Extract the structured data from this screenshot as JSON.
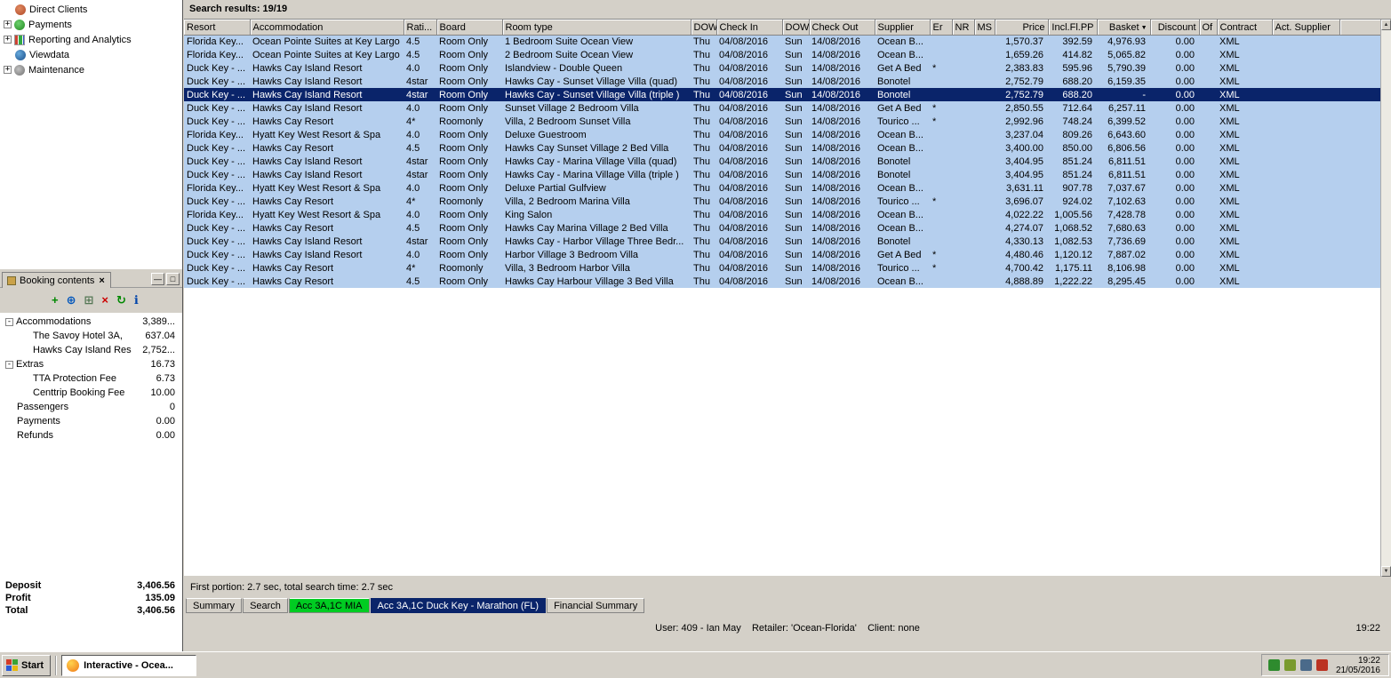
{
  "colors": {
    "selection": "#0a246a",
    "row_highlight": "#b5cfee",
    "tab_green": "#00cc22",
    "window_gray": "#d4d0c8"
  },
  "nav_tree": {
    "items": [
      {
        "label": "Direct Clients",
        "icon": "direct-clients",
        "expandable": false
      },
      {
        "label": "Payments",
        "icon": "payments",
        "expandable": true
      },
      {
        "label": "Reporting and Analytics",
        "icon": "reporting",
        "expandable": true
      },
      {
        "label": "Viewdata",
        "icon": "viewdata",
        "expandable": false
      },
      {
        "label": "Maintenance",
        "icon": "maintenance",
        "expandable": true
      }
    ]
  },
  "booking_panel": {
    "title": "Booking contents",
    "close_glyph": "×",
    "window_buttons": [
      {
        "name": "minimize-button",
        "glyph": "—"
      },
      {
        "name": "restore-button",
        "glyph": "□"
      }
    ],
    "toolbar": [
      {
        "name": "add-icon",
        "glyph": "+",
        "color": "#008800"
      },
      {
        "name": "globe-icon",
        "glyph": "⊕",
        "color": "#0055bb"
      },
      {
        "name": "export-icon",
        "glyph": "⊞",
        "color": "#557755"
      },
      {
        "name": "delete-icon",
        "glyph": "×",
        "color": "#cc0000"
      },
      {
        "name": "refresh-icon",
        "glyph": "↻",
        "color": "#008800"
      },
      {
        "name": "info-icon",
        "glyph": "ℹ",
        "color": "#0044aa"
      }
    ],
    "tree": [
      {
        "label": "Accommodations",
        "value": "3,389...",
        "level": 0,
        "expandable": true
      },
      {
        "label": "The Savoy Hotel  3A,",
        "value": "637.04",
        "level": 1
      },
      {
        "label": "Hawks Cay Island Res",
        "value": "2,752...",
        "level": 1
      },
      {
        "label": "Extras",
        "value": "16.73",
        "level": 0,
        "expandable": true
      },
      {
        "label": "TTA Protection Fee",
        "value": "6.73",
        "level": 1
      },
      {
        "label": "Centtrip Booking Fee",
        "value": "10.00",
        "level": 1
      },
      {
        "label": "Passengers",
        "value": "0",
        "level": 0
      },
      {
        "label": "Payments",
        "value": "0.00",
        "level": 0
      },
      {
        "label": "Refunds",
        "value": "0.00",
        "level": 0
      }
    ],
    "summary": [
      {
        "label": "Deposit",
        "value": "3,406.56"
      },
      {
        "label": "Profit",
        "value": "135.09"
      },
      {
        "label": "Total",
        "value": "3,406.56"
      }
    ]
  },
  "results": {
    "header": "Search results: 19/19",
    "columns": [
      "Resort",
      "Accommodation",
      "Rati...",
      "Board",
      "Room type",
      "DOW",
      "Check In",
      "DOW",
      "Check Out",
      "Supplier",
      "Er",
      "NR",
      "MS",
      "Price",
      "Incl.Fl.PP",
      "Basket",
      "Discount",
      "Of",
      "Contract",
      "Act. Supplier"
    ],
    "sorted_column_index": 15,
    "sort_indicator": "▼",
    "selected_row_index": 4,
    "status_text": "First portion: 2.7 sec, total search time: 2.7 sec",
    "rows": [
      [
        "Florida Key...",
        "Ocean Pointe Suites at Key Largo",
        "4.5",
        "Room Only",
        "1 Bedroom Suite Ocean View",
        "Thu",
        "04/08/2016",
        "Sun",
        "14/08/2016",
        "Ocean B...",
        "",
        "",
        "",
        "1,570.37",
        "392.59",
        "4,976.93",
        "0.00",
        "",
        "XML",
        ""
      ],
      [
        "Florida Key...",
        "Ocean Pointe Suites at Key Largo",
        "4.5",
        "Room Only",
        "2 Bedroom Suite Ocean View",
        "Thu",
        "04/08/2016",
        "Sun",
        "14/08/2016",
        "Ocean B...",
        "",
        "",
        "",
        "1,659.26",
        "414.82",
        "5,065.82",
        "0.00",
        "",
        "XML",
        ""
      ],
      [
        "Duck Key - ...",
        "Hawks Cay Island Resort",
        "4.0",
        "Room Only",
        "Islandview - Double Queen",
        "Thu",
        "04/08/2016",
        "Sun",
        "14/08/2016",
        "Get A Bed",
        "*",
        "",
        "",
        "2,383.83",
        "595.96",
        "5,790.39",
        "0.00",
        "",
        "XML",
        ""
      ],
      [
        "Duck Key - ...",
        "Hawks Cay Island Resort",
        "4star",
        "Room Only",
        "Hawks Cay - Sunset Village Villa (quad)",
        "Thu",
        "04/08/2016",
        "Sun",
        "14/08/2016",
        "Bonotel",
        "",
        "",
        "",
        "2,752.79",
        "688.20",
        "6,159.35",
        "0.00",
        "",
        "XML",
        ""
      ],
      [
        "Duck Key - ...",
        "Hawks Cay Island Resort",
        "4star",
        "Room Only",
        "Hawks Cay - Sunset Village Villa (triple )",
        "Thu",
        "04/08/2016",
        "Sun",
        "14/08/2016",
        "Bonotel",
        "",
        "",
        "",
        "2,752.79",
        "688.20",
        "-",
        "0.00",
        "",
        "XML",
        ""
      ],
      [
        "Duck Key - ...",
        "Hawks Cay Island Resort",
        "4.0",
        "Room Only",
        "Sunset Village 2 Bedroom Villa",
        "Thu",
        "04/08/2016",
        "Sun",
        "14/08/2016",
        "Get A Bed",
        "*",
        "",
        "",
        "2,850.55",
        "712.64",
        "6,257.11",
        "0.00",
        "",
        "XML",
        ""
      ],
      [
        "Duck Key - ...",
        "Hawks Cay Resort",
        "4*",
        "Roomonly",
        "Villa, 2 Bedroom Sunset Villa",
        "Thu",
        "04/08/2016",
        "Sun",
        "14/08/2016",
        "Tourico ...",
        "*",
        "",
        "",
        "2,992.96",
        "748.24",
        "6,399.52",
        "0.00",
        "",
        "XML",
        ""
      ],
      [
        "Florida Key...",
        "Hyatt Key West Resort & Spa",
        "4.0",
        "Room Only",
        "Deluxe Guestroom",
        "Thu",
        "04/08/2016",
        "Sun",
        "14/08/2016",
        "Ocean B...",
        "",
        "",
        "",
        "3,237.04",
        "809.26",
        "6,643.60",
        "0.00",
        "",
        "XML",
        ""
      ],
      [
        "Duck Key - ...",
        "Hawks Cay Resort",
        "4.5",
        "Room Only",
        "Hawks Cay Sunset Village 2 Bed Villa",
        "Thu",
        "04/08/2016",
        "Sun",
        "14/08/2016",
        "Ocean B...",
        "",
        "",
        "",
        "3,400.00",
        "850.00",
        "6,806.56",
        "0.00",
        "",
        "XML",
        ""
      ],
      [
        "Duck Key - ...",
        "Hawks Cay Island Resort",
        "4star",
        "Room Only",
        "Hawks Cay - Marina Village Villa (quad)",
        "Thu",
        "04/08/2016",
        "Sun",
        "14/08/2016",
        "Bonotel",
        "",
        "",
        "",
        "3,404.95",
        "851.24",
        "6,811.51",
        "0.00",
        "",
        "XML",
        ""
      ],
      [
        "Duck Key - ...",
        "Hawks Cay Island Resort",
        "4star",
        "Room Only",
        "Hawks Cay - Marina Village Villa (triple )",
        "Thu",
        "04/08/2016",
        "Sun",
        "14/08/2016",
        "Bonotel",
        "",
        "",
        "",
        "3,404.95",
        "851.24",
        "6,811.51",
        "0.00",
        "",
        "XML",
        ""
      ],
      [
        "Florida Key...",
        "Hyatt Key West Resort & Spa",
        "4.0",
        "Room Only",
        "Deluxe Partial Gulfview",
        "Thu",
        "04/08/2016",
        "Sun",
        "14/08/2016",
        "Ocean B...",
        "",
        "",
        "",
        "3,631.11",
        "907.78",
        "7,037.67",
        "0.00",
        "",
        "XML",
        ""
      ],
      [
        "Duck Key - ...",
        "Hawks Cay Resort",
        "4*",
        "Roomonly",
        "Villa, 2 Bedroom Marina Villa",
        "Thu",
        "04/08/2016",
        "Sun",
        "14/08/2016",
        "Tourico ...",
        "*",
        "",
        "",
        "3,696.07",
        "924.02",
        "7,102.63",
        "0.00",
        "",
        "XML",
        ""
      ],
      [
        "Florida Key...",
        "Hyatt Key West Resort & Spa",
        "4.0",
        "Room Only",
        "King Salon",
        "Thu",
        "04/08/2016",
        "Sun",
        "14/08/2016",
        "Ocean B...",
        "",
        "",
        "",
        "4,022.22",
        "1,005.56",
        "7,428.78",
        "0.00",
        "",
        "XML",
        ""
      ],
      [
        "Duck Key - ...",
        "Hawks Cay Resort",
        "4.5",
        "Room Only",
        "Hawks Cay Marina Village 2 Bed Villa",
        "Thu",
        "04/08/2016",
        "Sun",
        "14/08/2016",
        "Ocean B...",
        "",
        "",
        "",
        "4,274.07",
        "1,068.52",
        "7,680.63",
        "0.00",
        "",
        "XML",
        ""
      ],
      [
        "Duck Key - ...",
        "Hawks Cay Island Resort",
        "4star",
        "Room Only",
        "Hawks Cay - Harbor Village Three Bedr...",
        "Thu",
        "04/08/2016",
        "Sun",
        "14/08/2016",
        "Bonotel",
        "",
        "",
        "",
        "4,330.13",
        "1,082.53",
        "7,736.69",
        "0.00",
        "",
        "XML",
        ""
      ],
      [
        "Duck Key - ...",
        "Hawks Cay Island Resort",
        "4.0",
        "Room Only",
        "Harbor Village 3 Bedroom Villa",
        "Thu",
        "04/08/2016",
        "Sun",
        "14/08/2016",
        "Get A Bed",
        "*",
        "",
        "",
        "4,480.46",
        "1,120.12",
        "7,887.02",
        "0.00",
        "",
        "XML",
        ""
      ],
      [
        "Duck Key - ...",
        "Hawks Cay Resort",
        "4*",
        "Roomonly",
        "Villa, 3 Bedroom Harbor Villa",
        "Thu",
        "04/08/2016",
        "Sun",
        "14/08/2016",
        "Tourico ...",
        "*",
        "",
        "",
        "4,700.42",
        "1,175.11",
        "8,106.98",
        "0.00",
        "",
        "XML",
        ""
      ],
      [
        "Duck Key - ...",
        "Hawks Cay Resort",
        "4.5",
        "Room Only",
        "Hawks Cay Harbour Village 3 Bed Villa",
        "Thu",
        "04/08/2016",
        "Sun",
        "14/08/2016",
        "Ocean B...",
        "",
        "",
        "",
        "4,888.89",
        "1,222.22",
        "8,295.45",
        "0.00",
        "",
        "XML",
        ""
      ]
    ]
  },
  "tabs": [
    {
      "label": "Summary",
      "state": "normal"
    },
    {
      "label": "Search",
      "state": "normal"
    },
    {
      "label": "Acc 3A,1C MIA",
      "state": "green"
    },
    {
      "label": "Acc 3A,1C Duck Key - Marathon (FL)",
      "state": "active"
    },
    {
      "label": "Financial Summary",
      "state": "normal"
    }
  ],
  "status_bar": {
    "text": "User: 409 - Ian May    Retailer: 'Ocean-Florida'    Client: none",
    "time": "19:22"
  },
  "taskbar": {
    "start_label": "Start",
    "task_label": "Interactive - Ocea...",
    "tray_icons": [
      {
        "name": "tray-network-icon",
        "color": "#2e8b2e"
      },
      {
        "name": "tray-message-icon",
        "color": "#7a9a2e"
      },
      {
        "name": "tray-display-icon",
        "color": "#4a6a8a"
      },
      {
        "name": "tray-alert-icon",
        "color": "#bb3322"
      }
    ],
    "time": "19:22",
    "date": "21/05/2016"
  }
}
